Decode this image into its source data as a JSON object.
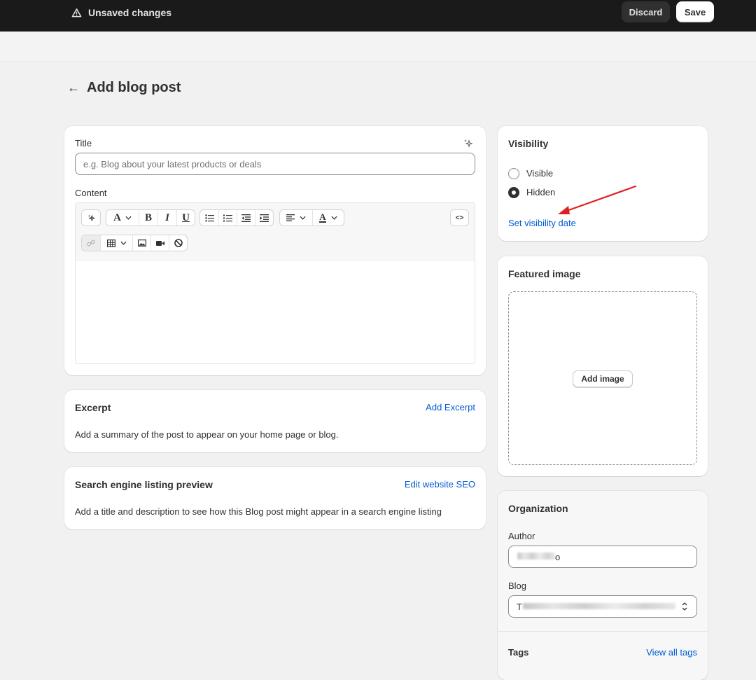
{
  "topbar": {
    "status_text": "Unsaved changes",
    "discard_label": "Discard",
    "save_label": "Save"
  },
  "page": {
    "back_icon": "arrow-left-icon",
    "title": "Add blog post"
  },
  "post_card": {
    "title_label": "Title",
    "title_value": "",
    "title_placeholder": "e.g. Blog about your latest products or deals",
    "content_label": "Content",
    "toolbar_row1": [
      "magic",
      "font",
      "bold",
      "italic",
      "underline",
      "bullet-list",
      "numbered-list",
      "outdent",
      "indent",
      "align",
      "text-color",
      "code"
    ],
    "toolbar_row2": [
      "link",
      "table",
      "image",
      "video",
      "clear-format"
    ],
    "toolbar_glyphs": {
      "font": "A",
      "bold": "B",
      "italic": "I",
      "underline": "U",
      "text_color": "A",
      "code": "<>"
    }
  },
  "excerpt_card": {
    "heading": "Excerpt",
    "action": "Add Excerpt",
    "description": "Add a summary of the post to appear on your home page or blog."
  },
  "seo_card": {
    "heading": "Search engine listing preview",
    "action": "Edit website SEO",
    "description": "Add a title and description to see how this Blog post might appear in a search engine listing"
  },
  "visibility_card": {
    "heading": "Visibility",
    "options": [
      {
        "label": "Visible",
        "selected": false
      },
      {
        "label": "Hidden",
        "selected": true
      }
    ],
    "set_date_link": "Set visibility date",
    "annotation_color": "#e02020"
  },
  "featured_card": {
    "heading": "Featured image",
    "add_button": "Add image"
  },
  "organization_card": {
    "heading": "Organization",
    "author_label": "Author",
    "author_value_visible": "o",
    "blog_label": "Blog",
    "blog_value_visible": "T",
    "tags_label": "Tags",
    "tags_link": "View all tags"
  },
  "colors": {
    "topbar_bg": "#1a1a1a",
    "page_bg": "#f1f1f1",
    "link": "#005bd3",
    "text": "#303030"
  }
}
